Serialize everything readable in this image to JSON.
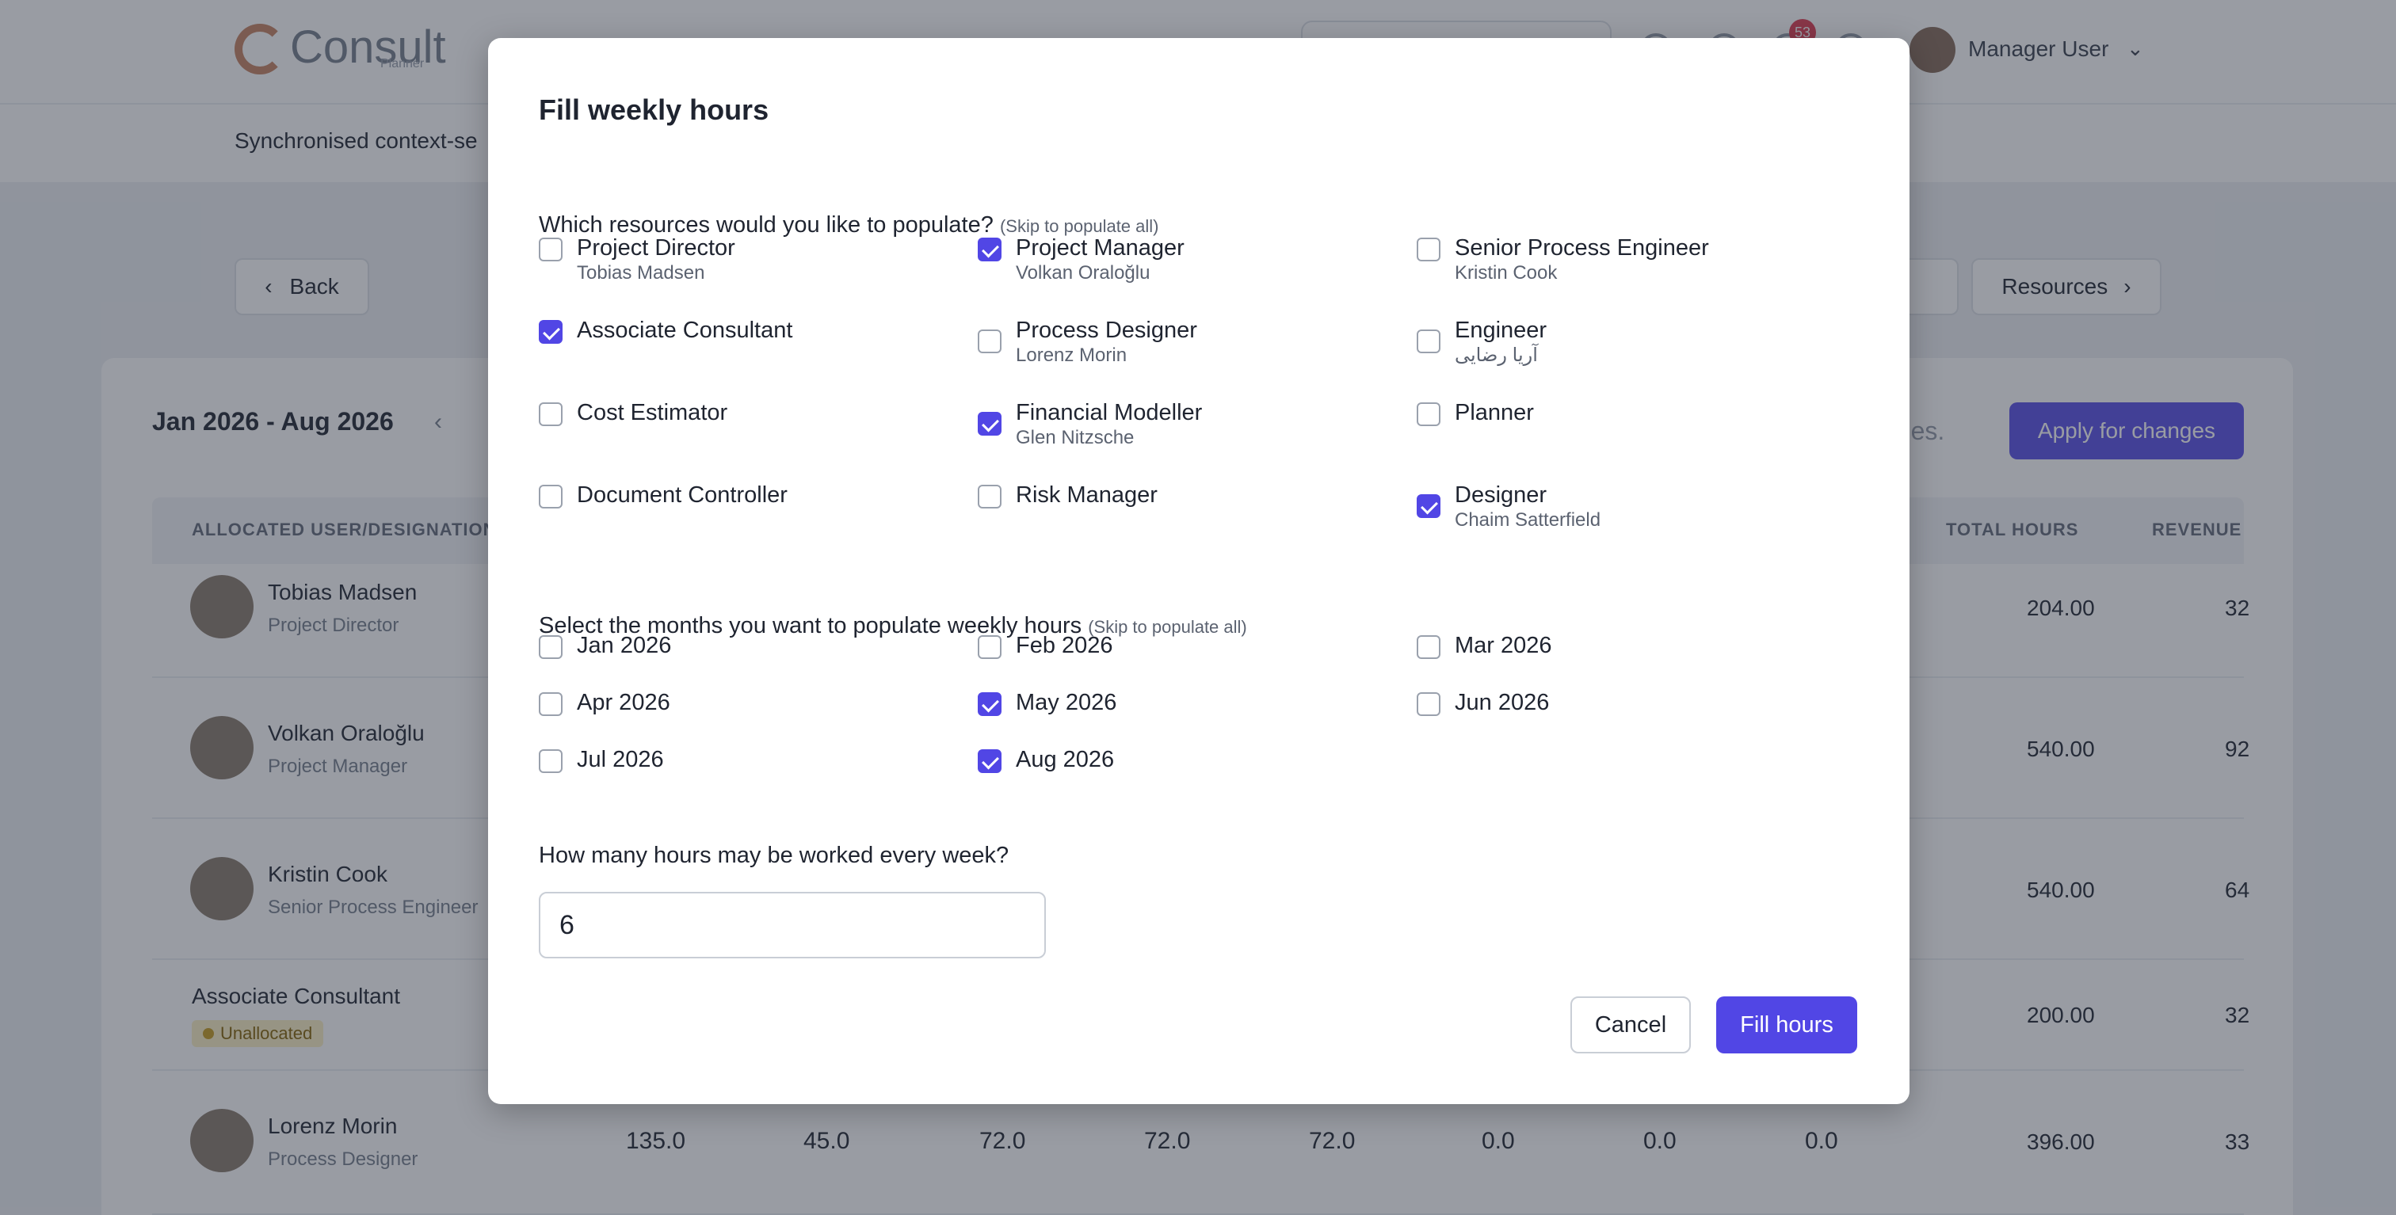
{
  "header": {
    "logo_text": "Consult",
    "logo_sub": "Planner",
    "notification_count": "53",
    "user_name": "Manager User"
  },
  "subheader": {
    "context_text": "Synchronised context-se"
  },
  "toolbar": {
    "back_label": "Back",
    "resources_label": "Resources"
  },
  "planner": {
    "period": "Jan 2026 - Aug 2026",
    "changes_text": "nges.",
    "apply_label": "Apply for changes",
    "columns": {
      "user": "ALLOCATED USER/DESIGNATION",
      "total": "TOTAL HOURS",
      "revenue": "REVENUE"
    },
    "rows": [
      {
        "name": "Tobias Madsen",
        "role": "Project Director",
        "total": "204.00",
        "revenue": "32"
      },
      {
        "name": "Volkan Oraloğlu",
        "role": "Project Manager",
        "total": "540.00",
        "revenue": "92"
      },
      {
        "name": "Kristin Cook",
        "role": "Senior Process Engineer",
        "total": "540.00",
        "revenue": "64"
      },
      {
        "name": "Associate Consultant",
        "role": "Unallocated",
        "total": "200.00",
        "revenue": "32"
      },
      {
        "name": "Lorenz Morin",
        "role": "Process Designer",
        "total": "396.00",
        "revenue": "33"
      }
    ],
    "last_row_months": [
      "135.0",
      "45.0",
      "72.0",
      "72.0",
      "72.0",
      "0.0",
      "0.0",
      "0.0"
    ]
  },
  "modal": {
    "title": "Fill weekly hours",
    "resources_question": "Which resources would you like to populate?",
    "resources_skip": "(Skip to populate all)",
    "resources": [
      {
        "label": "Project Director",
        "sub": "Tobias Madsen",
        "checked": false
      },
      {
        "label": "Project Manager",
        "sub": "Volkan Oraloğlu",
        "checked": true
      },
      {
        "label": "Senior Process Engineer",
        "sub": "Kristin Cook",
        "checked": false
      },
      {
        "label": "Associate Consultant",
        "sub": "",
        "checked": true
      },
      {
        "label": "Process Designer",
        "sub": "Lorenz Morin",
        "checked": false
      },
      {
        "label": "Engineer",
        "sub": "آریا رضایی",
        "checked": false
      },
      {
        "label": "Cost Estimator",
        "sub": "",
        "checked": false
      },
      {
        "label": "Financial Modeller",
        "sub": "Glen Nitzsche",
        "checked": true
      },
      {
        "label": "Planner",
        "sub": "",
        "checked": false
      },
      {
        "label": "Document Controller",
        "sub": "",
        "checked": false
      },
      {
        "label": "Risk Manager",
        "sub": "",
        "checked": false
      },
      {
        "label": "Designer",
        "sub": "Chaim Satterfield",
        "checked": true
      }
    ],
    "months_question": "Select the months you want to populate weekly hours",
    "months_skip": "(Skip to populate all)",
    "months": [
      {
        "label": "Jan 2026",
        "checked": false
      },
      {
        "label": "Feb 2026",
        "checked": false
      },
      {
        "label": "Mar 2026",
        "checked": false
      },
      {
        "label": "Apr 2026",
        "checked": false
      },
      {
        "label": "May 2026",
        "checked": true
      },
      {
        "label": "Jun 2026",
        "checked": false
      },
      {
        "label": "Jul 2026",
        "checked": false
      },
      {
        "label": "Aug 2026",
        "checked": true
      }
    ],
    "hours_question": "How many hours may be worked every week?",
    "hours_value": "6",
    "cancel_label": "Cancel",
    "fill_label": "Fill hours"
  },
  "colors": {
    "accent": "#5146e5",
    "apply_button": "#6258e8",
    "overlay": "rgba(28,36,52,0.45)"
  }
}
